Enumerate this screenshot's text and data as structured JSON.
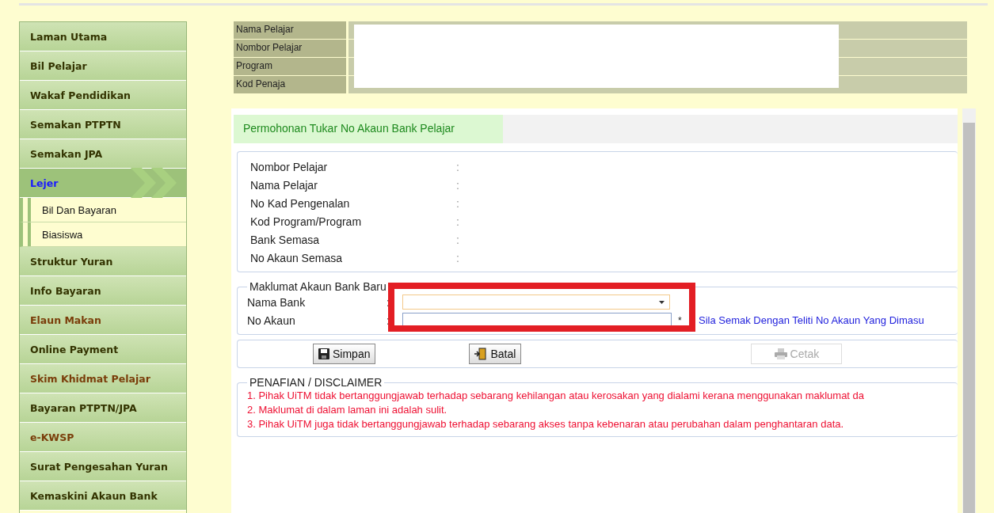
{
  "sidebar": {
    "items": [
      {
        "label": "Laman Utama",
        "selected": false,
        "color": "#333300"
      },
      {
        "label": "Bil Pelajar",
        "selected": false,
        "color": "#333300"
      },
      {
        "label": "Wakaf Pendidikan",
        "selected": false,
        "color": "#333300"
      },
      {
        "label": "Semakan PTPTN",
        "selected": false,
        "color": "#333300"
      },
      {
        "label": "Semakan JPA",
        "selected": false,
        "color": "#333300"
      },
      {
        "label": "Lejer",
        "selected": true,
        "children": [
          {
            "label": "Bil Dan Bayaran"
          },
          {
            "label": "Biasiswa"
          }
        ]
      },
      {
        "label": "Struktur Yuran",
        "selected": false,
        "color": "#333300"
      },
      {
        "label": "Info Bayaran",
        "selected": false,
        "color": "#333300"
      },
      {
        "label": "Elaun Makan",
        "selected": false,
        "color": "#7a3d0a"
      },
      {
        "label": "Online Payment",
        "selected": false,
        "color": "#333300"
      },
      {
        "label": "Skim Khidmat Pelajar",
        "selected": false,
        "color": "#7a3d0a"
      },
      {
        "label": "Bayaran PTPTN/JPA",
        "selected": false,
        "color": "#333300"
      },
      {
        "label": "e-KWSP",
        "selected": false,
        "color": "#7a3d0a"
      },
      {
        "label": "Surat Pengesahan Yuran",
        "selected": false,
        "color": "#333300"
      },
      {
        "label": "Kemaskini Akaun Bank",
        "selected": false,
        "color": "#333300"
      }
    ]
  },
  "student_info": [
    "Nama Pelajar",
    "Nombor Pelajar",
    "Program",
    "Kod Penaja"
  ],
  "panel": {
    "title": "Permohonan Tukar No Akaun Bank Pelajar",
    "current_details": [
      "Nombor Pelajar",
      "Nama Pelajar",
      "No Kad Pengenalan",
      "Kod Program/Program",
      "Bank Semasa",
      "No Akaun Semasa"
    ],
    "separator": ":",
    "new_account": {
      "legend": "Maklumat Akaun Bank Baru",
      "bank_label": "Nama Bank",
      "account_label": "No Akaun",
      "required_mark": "*",
      "note": "Sila Semak Dengan Teliti No Akaun Yang Dimasu"
    },
    "buttons": [
      {
        "label": "Simpan",
        "disabled": false,
        "kind": "save"
      },
      {
        "label": "Batal",
        "disabled": false,
        "kind": "cancel"
      },
      {
        "label": "Cetak",
        "disabled": true,
        "kind": "print"
      }
    ],
    "disclaimer": {
      "legend": "PENAFIAN / DISCLAIMER",
      "lines": [
        "1. Pihak UiTM tidak bertanggungjawab terhadap sebarang kehilangan atau kerosakan yang dialami kerana menggunakan maklumat da",
        "2. Maklumat di dalam laman ini adalah sulit.",
        "3. Pihak UiTM juga tidak bertanggungjawab terhadap sebarang akses tanpa kebenaran atau perubahan dalam penghantaran data."
      ]
    }
  }
}
